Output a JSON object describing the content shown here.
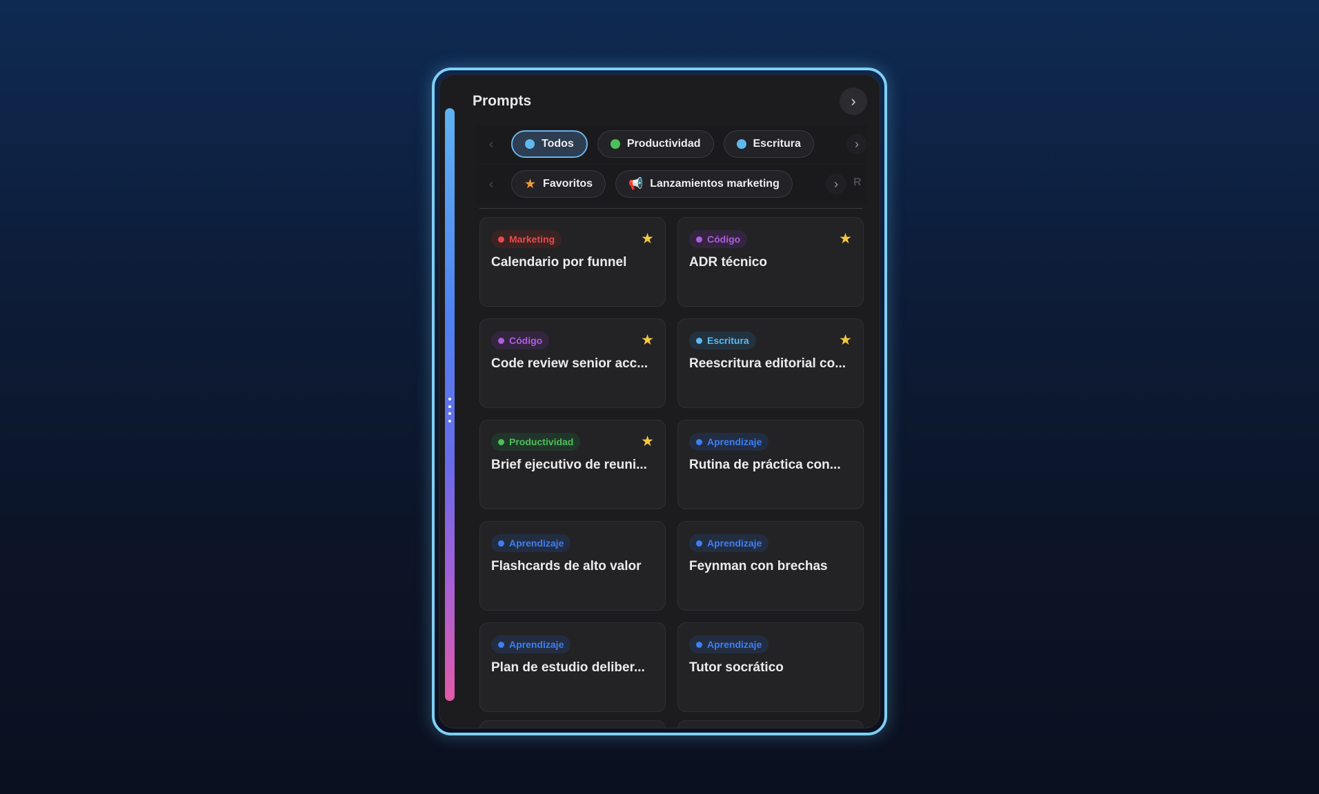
{
  "header": {
    "title": "Prompts",
    "collapse_icon": "chevron-right-icon"
  },
  "colors": {
    "accent_border": "#7ed0f5",
    "marketing": "#e84a4a",
    "codigo": "#b05de0",
    "escritura": "#5fb8ee",
    "productividad": "#4cc05a",
    "aprendizaje": "#3f7ff0",
    "favorite_star": "#f5c842"
  },
  "filters": {
    "categories": [
      {
        "label": "Todos",
        "color": "#5fb8ee",
        "active": true
      },
      {
        "label": "Productividad",
        "color": "#4cc05a",
        "active": false
      },
      {
        "label": "Escritura",
        "color": "#5fb8ee",
        "active": false
      }
    ],
    "collections": [
      {
        "label": "Favoritos",
        "icon": "star-icon"
      },
      {
        "label": "Lanzamientos marketing",
        "icon": "megaphone-icon"
      }
    ],
    "collections_partial": "R"
  },
  "cards": [
    {
      "tag": "Marketing",
      "tag_color": "#e84a4a",
      "tag_bg": "#3a2323",
      "title": "Calendario por funnel",
      "favorite": true
    },
    {
      "tag": "Código",
      "tag_color": "#b05de0",
      "tag_bg": "#33253e",
      "title": "ADR técnico",
      "favorite": true
    },
    {
      "tag": "Código",
      "tag_color": "#b05de0",
      "tag_bg": "#33253e",
      "title": "Code review senior acc...",
      "favorite": true
    },
    {
      "tag": "Escritura",
      "tag_color": "#5fb8ee",
      "tag_bg": "#23323f",
      "title": "Reescritura editorial co...",
      "favorite": true
    },
    {
      "tag": "Productividad",
      "tag_color": "#4cc05a",
      "tag_bg": "#22352a",
      "title": "Brief ejecutivo de reuni...",
      "favorite": true
    },
    {
      "tag": "Aprendizaje",
      "tag_color": "#3f7ff0",
      "tag_bg": "#232d42",
      "title": "Rutina de práctica con...",
      "favorite": false
    },
    {
      "tag": "Aprendizaje",
      "tag_color": "#3f7ff0",
      "tag_bg": "#232d42",
      "title": "Flashcards de alto valor",
      "favorite": false
    },
    {
      "tag": "Aprendizaje",
      "tag_color": "#3f7ff0",
      "tag_bg": "#232d42",
      "title": "Feynman con brechas",
      "favorite": false
    },
    {
      "tag": "Aprendizaje",
      "tag_color": "#3f7ff0",
      "tag_bg": "#232d42",
      "title": "Plan de estudio deliber...",
      "favorite": false
    },
    {
      "tag": "Aprendizaje",
      "tag_color": "#3f7ff0",
      "tag_bg": "#232d42",
      "title": "Tutor socrático",
      "favorite": false
    }
  ]
}
